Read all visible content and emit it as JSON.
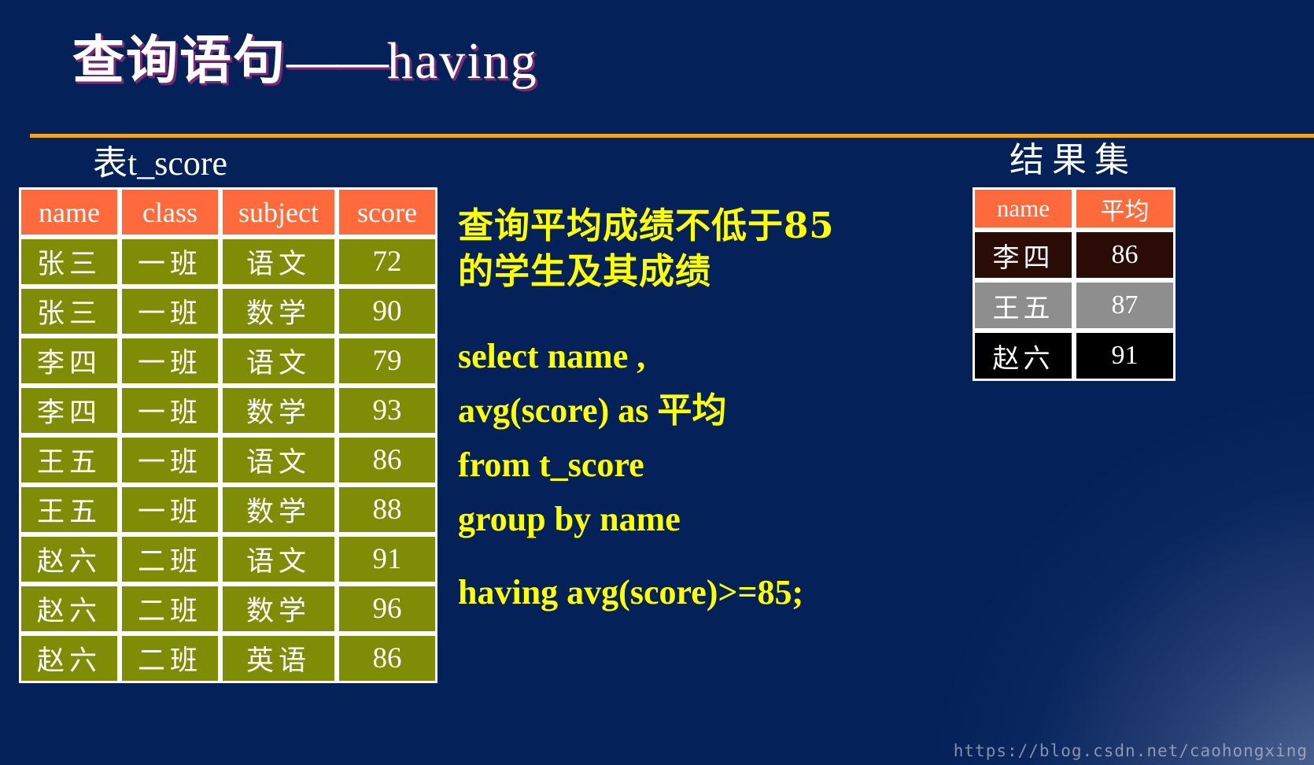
{
  "slide": {
    "title_cn": "查询语句",
    "title_dash": "——",
    "title_en": "having",
    "accent_rule_color": "#f4a61b",
    "background_color": "#04215a"
  },
  "captions": {
    "source_table_cn": "表",
    "source_table_name": "t_score",
    "result_set": "结果集"
  },
  "source_table": {
    "headers": [
      "name",
      "class",
      "subject",
      "score"
    ],
    "header_bg": "#ff6a3c",
    "row_bg": "#7f8c06",
    "rows": [
      [
        "张三",
        "一班",
        "语文",
        "72"
      ],
      [
        "张三",
        "一班",
        "数学",
        "90"
      ],
      [
        "李四",
        "一班",
        "语文",
        "79"
      ],
      [
        "李四",
        "一班",
        "数学",
        "93"
      ],
      [
        "王五",
        "一班",
        "语文",
        "86"
      ],
      [
        "王五",
        "一班",
        "数学",
        "88"
      ],
      [
        "赵六",
        "二班",
        "语文",
        "91"
      ],
      [
        "赵六",
        "二班",
        "数学",
        "96"
      ],
      [
        "赵六",
        "二班",
        "英语",
        "86"
      ]
    ]
  },
  "result_table": {
    "headers": [
      "name",
      "平均"
    ],
    "header_bg": "#ff6a3c",
    "row_bgs": [
      "#2b0b05",
      "#8e8e8e",
      "#000000"
    ],
    "rows": [
      [
        "李四",
        "86"
      ],
      [
        "王五",
        "87"
      ],
      [
        "赵六",
        "91"
      ]
    ]
  },
  "prompt": {
    "line1": "查询平均成绩不低于85",
    "line2": "的学生及其成绩",
    "color": "#ffff00"
  },
  "sql": {
    "color": "#ffff00",
    "line1": "select  name ,",
    "line2_a": "avg(score)  as ",
    "line2_b": "平均",
    "line3": "from  t_score",
    "line4": "group by name",
    "line5": "having avg(score)>=85;"
  },
  "watermark": {
    "text": "https://blog.csdn.net/caohongxing"
  }
}
